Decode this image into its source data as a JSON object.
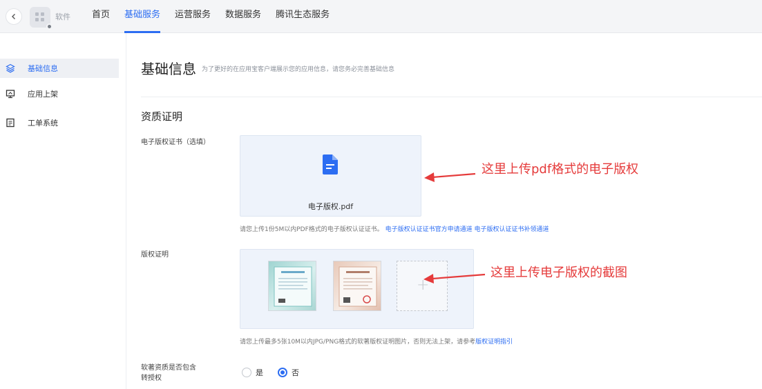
{
  "topbar": {
    "back_icon": "chevron-left-icon",
    "app_name": "软件",
    "nav": [
      {
        "label": "首页",
        "active": false
      },
      {
        "label": "基础服务",
        "active": true
      },
      {
        "label": "运营服务",
        "active": false
      },
      {
        "label": "数据服务",
        "active": false
      },
      {
        "label": "腾讯生态服务",
        "active": false
      }
    ]
  },
  "sidebar": {
    "items": [
      {
        "label": "基础信息",
        "icon": "layers-icon",
        "active": true
      },
      {
        "label": "应用上架",
        "icon": "monitor-icon",
        "active": false
      },
      {
        "label": "工单系统",
        "icon": "ticket-icon",
        "active": false
      }
    ]
  },
  "main": {
    "title": "基础信息",
    "description": "为了更好的在应用宝客户端展示您的应用信息，请您务必完善基础信息",
    "section_title": "资质证明",
    "copyright_cert": {
      "label": "电子版权证书（选填）",
      "file_name": "电子版权.pdf",
      "help_text": "请您上传1份5M以内PDF格式的电子版权认证证书。",
      "link1": "电子版权认证证书官方申请通道",
      "link2": "电子版权认证证书补领通道"
    },
    "copyright_proof": {
      "label": "版权证明",
      "help_text": "请您上传最多5张10M以内JPG/PNG格式的软著版权证明图片，否则无法上架，请参考",
      "link": "版权证明指引"
    },
    "transfer": {
      "label_line1": "软著资质是否包含",
      "label_line2": "转授权",
      "options": [
        {
          "label": "是",
          "checked": false
        },
        {
          "label": "否",
          "checked": true
        }
      ]
    }
  },
  "annotations": {
    "pdf_note": "这里上传pdf格式的电子版权",
    "screenshot_note": "这里上传电子版权的截图"
  },
  "colors": {
    "accent": "#2c6df2",
    "annotation": "#e53b3b",
    "upload_bg": "#eef3fb"
  }
}
